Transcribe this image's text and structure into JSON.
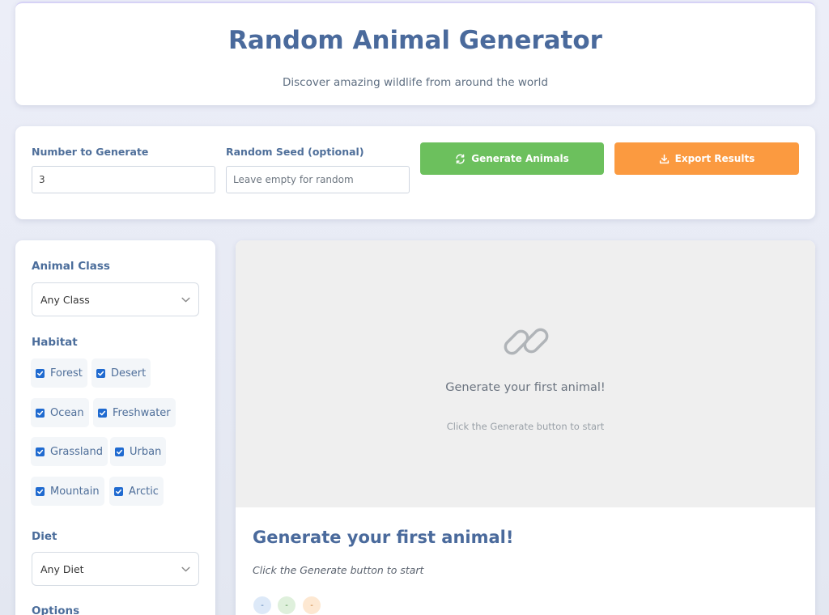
{
  "header": {
    "title": "Random Animal Generator",
    "subtitle": "Discover amazing wildlife from around the world"
  },
  "controls": {
    "count_label": "Number to Generate",
    "count_value": "3",
    "seed_label": "Random Seed (optional)",
    "seed_placeholder": "Leave empty for random",
    "generate_label": "Generate Animals",
    "export_label": "Export Results",
    "generate_color": "#6cc05d",
    "export_color": "#fb9a40"
  },
  "sidebar": {
    "class_label": "Animal Class",
    "class_value": "Any Class",
    "habitat_label": "Habitat",
    "habitats": [
      {
        "label": "Forest",
        "checked": true
      },
      {
        "label": "Desert",
        "checked": true
      },
      {
        "label": "Ocean",
        "checked": true
      },
      {
        "label": "Freshwater",
        "checked": true
      },
      {
        "label": "Grassland",
        "checked": true
      },
      {
        "label": "Urban",
        "checked": true
      },
      {
        "label": "Mountain",
        "checked": true
      },
      {
        "label": "Arctic",
        "checked": true
      }
    ],
    "diet_label": "Diet",
    "diet_value": "Any Diet",
    "options_label": "Options"
  },
  "result": {
    "placeholder_icon": "link-icon",
    "placeholder_title": "Generate your first animal!",
    "placeholder_sub": "Click the Generate button to start",
    "title": "Generate your first animal!",
    "description": "Click the Generate button to start",
    "badges": [
      "-",
      "-",
      "-"
    ]
  }
}
